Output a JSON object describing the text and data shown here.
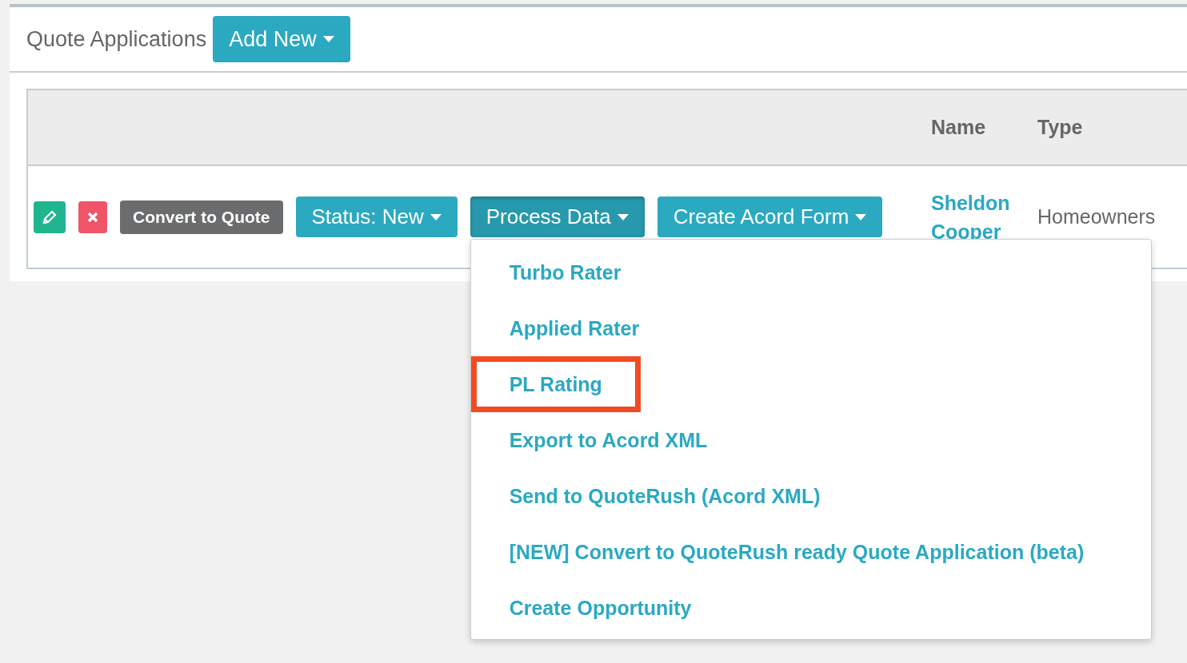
{
  "panel": {
    "title": "Quote Applications",
    "add_button": {
      "label": "Add New"
    }
  },
  "table": {
    "columns": [
      "Name",
      "Type"
    ],
    "rows": [
      {
        "actions": [
          {
            "kind": "edit"
          },
          {
            "kind": "delete"
          },
          {
            "kind": "convert",
            "label": "Convert to Quote"
          },
          {
            "kind": "dropdown",
            "label": "Status: New",
            "open": false
          },
          {
            "kind": "dropdown",
            "label": "Process Data",
            "open": true,
            "menu": [
              {
                "label": "Turbo Rater",
                "highlighted": false
              },
              {
                "label": "Applied Rater",
                "highlighted": false
              },
              {
                "label": "PL Rating",
                "highlighted": true
              },
              {
                "label": "Export to Acord XML",
                "highlighted": false
              },
              {
                "label": "Send to QuoteRush (Acord XML)",
                "highlighted": false
              },
              {
                "label": "[NEW] Convert to QuoteRush ready Quote Application (beta)",
                "highlighted": false
              },
              {
                "label": "Create Opportunity",
                "highlighted": false
              }
            ]
          },
          {
            "kind": "dropdown",
            "label": "Create Acord Form",
            "open": false
          }
        ],
        "name": "Sheldon Cooper",
        "type": "Homeowners"
      }
    ]
  }
}
